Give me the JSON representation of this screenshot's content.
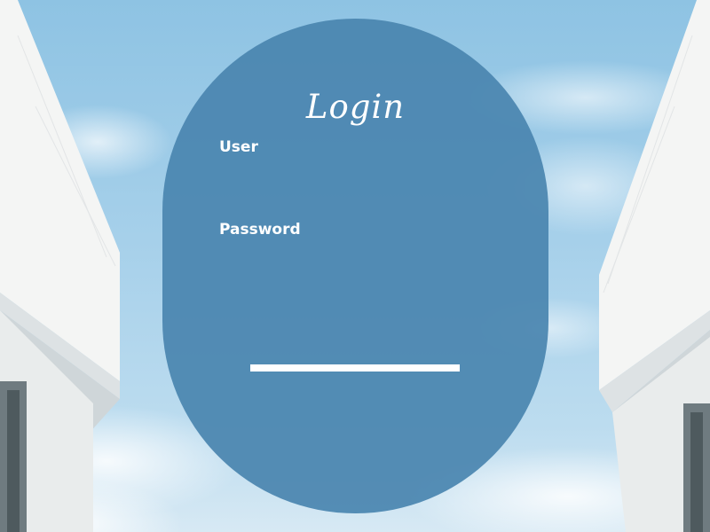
{
  "login": {
    "title": "Login",
    "user_label": "User",
    "user_value": "",
    "password_label": "Password",
    "password_value": ""
  },
  "colors": {
    "card": "#4a85af",
    "text": "#ffffff",
    "sky": "#a6d0ea"
  }
}
